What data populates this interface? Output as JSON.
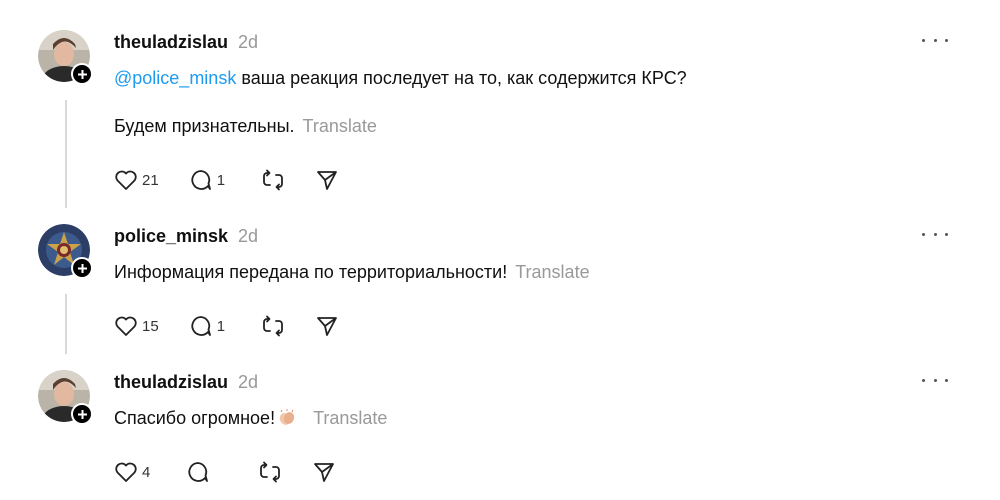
{
  "posts": [
    {
      "username": "theuladzislau",
      "time": "2d",
      "mention": "@police_minsk",
      "line1": " ваша реакция последует на то, как содержится КРС?",
      "line2": "Будем признательны.",
      "translate": "Translate",
      "likes": "21",
      "replies": "1"
    },
    {
      "username": "police_minsk",
      "time": "2d",
      "text": "Информация передана по территориальности!",
      "translate": "Translate",
      "likes": "15",
      "replies": "1"
    },
    {
      "username": "theuladzislau",
      "time": "2d",
      "text": "Спасибо огромное!",
      "translate": "Translate",
      "likes": "4",
      "replies": ""
    }
  ],
  "icons": [
    "heart-icon",
    "comment-icon",
    "repost-icon",
    "share-icon",
    "more-icon",
    "plus-icon",
    "clapping-emoji"
  ]
}
